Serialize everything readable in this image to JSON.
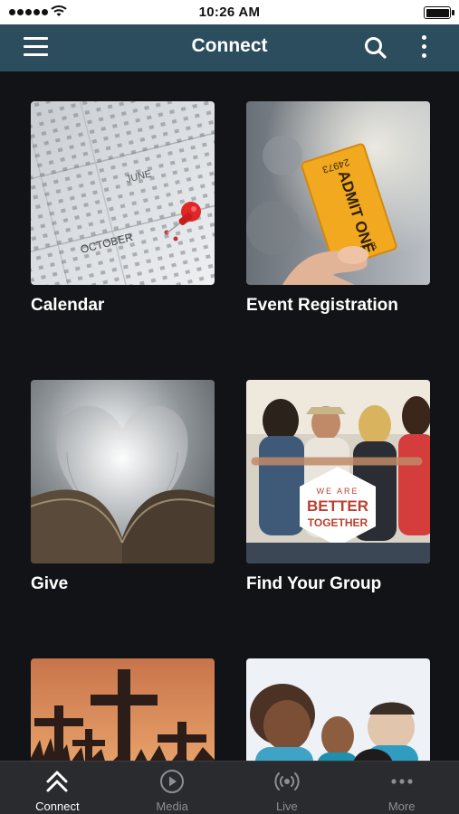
{
  "status_bar": {
    "time": "10:26 AM"
  },
  "header": {
    "title": "Connect"
  },
  "tiles": [
    {
      "label": "Calendar",
      "calendar_months": [
        "JUNE",
        "OCTOBER"
      ]
    },
    {
      "label": "Event Registration",
      "ticket_text": "ADMIT ONE",
      "ticket_number": "24973"
    },
    {
      "label": "Give"
    },
    {
      "label": "Find Your Group",
      "badge_line1": "WE ARE",
      "badge_line2": "BETTER",
      "badge_line3": "TOGETHER"
    },
    {
      "label": ""
    },
    {
      "label": ""
    }
  ],
  "tabs": [
    {
      "label": "Connect",
      "icon": "double-chevron-up-icon",
      "active": true
    },
    {
      "label": "Media",
      "icon": "play-circle-icon"
    },
    {
      "label": "Live",
      "icon": "broadcast-icon"
    },
    {
      "label": "More",
      "icon": "ellipsis-icon"
    }
  ],
  "colors": {
    "header": "#2c4d5e",
    "background": "#121316",
    "tab_bar": "#2a2b2f"
  }
}
